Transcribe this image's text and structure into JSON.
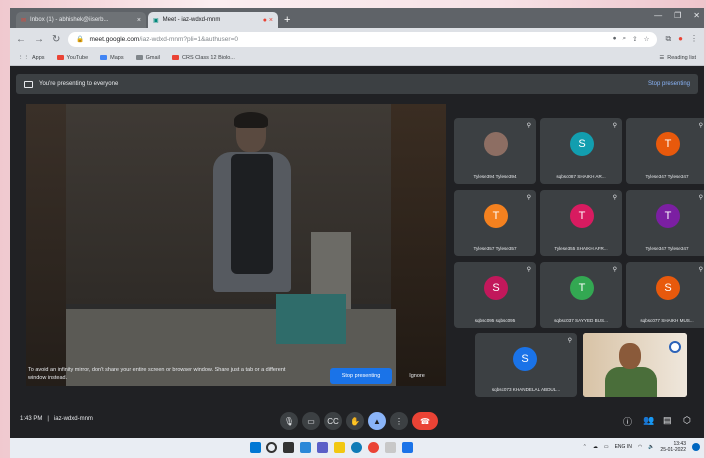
{
  "browser": {
    "tabs": [
      {
        "label": "Inbox (1) - abhishek@iiserb...",
        "active": false
      },
      {
        "label": "Meet - iaz-wdxd-mnm",
        "active": true
      }
    ],
    "new_tab_symbol": "+",
    "url_host": "meet.google.com",
    "url_path": "/iaz-wdxd-mnm?pli=1&authuser=0",
    "bookmarks": [
      {
        "label": "Apps",
        "icon": "apps-icon"
      },
      {
        "label": "YouTube",
        "icon": "youtube-icon"
      },
      {
        "label": "Maps",
        "icon": "maps-icon"
      },
      {
        "label": "Gmail",
        "icon": "gmail-icon"
      },
      {
        "label": "CRS Class 12 Biolo...",
        "icon": "youtube-icon"
      }
    ],
    "reading_list": "Reading list"
  },
  "meet": {
    "banner_text": "You're presenting to everyone",
    "banner_stop": "Stop presenting",
    "notice_text": "To avoid an infinity mirror, don't share your entire screen or browser window. Share just a tab or a different window instead.",
    "stop_presenting_label": "Stop presenting",
    "ignore_label": "Ignore",
    "participants": [
      {
        "initial": "",
        "name": "Tylese394 Tylese394",
        "color": "#8d6e63",
        "photo": true
      },
      {
        "initial": "S",
        "name": "sqbsc087 SHAIKH AR...",
        "color": "#129eaf"
      },
      {
        "initial": "T",
        "name": "Tylese347 Tylese347",
        "color": "#e8590c"
      },
      {
        "initial": "T",
        "name": "Tylese357 Tylese357",
        "color": "#f4811f"
      },
      {
        "initial": "T",
        "name": "Tylese355 SHAIKH AFR...",
        "color": "#d81b60"
      },
      {
        "initial": "T",
        "name": "Tylese347 Tylese347",
        "color": "#7b1fa2"
      },
      {
        "initial": "S",
        "name": "sqbsc095 sqbsc095",
        "color": "#c2185b"
      },
      {
        "initial": "T",
        "name": "sqbsc037 SAYYED BUS...",
        "color": "#33a852"
      },
      {
        "initial": "S",
        "name": "sqbsc077 SHAIKH MUS...",
        "color": "#e8590c"
      },
      {
        "initial": "S",
        "name": "sqbsc073 KHANDELAL ABDUL...",
        "color": "#1a73e8"
      }
    ],
    "meeting_time": "1:43 PM",
    "meeting_code": "iaz-wdxd-mnm"
  },
  "taskbar": {
    "time": "13:43",
    "date": "25-01-2022",
    "lang": "ENG IN"
  }
}
